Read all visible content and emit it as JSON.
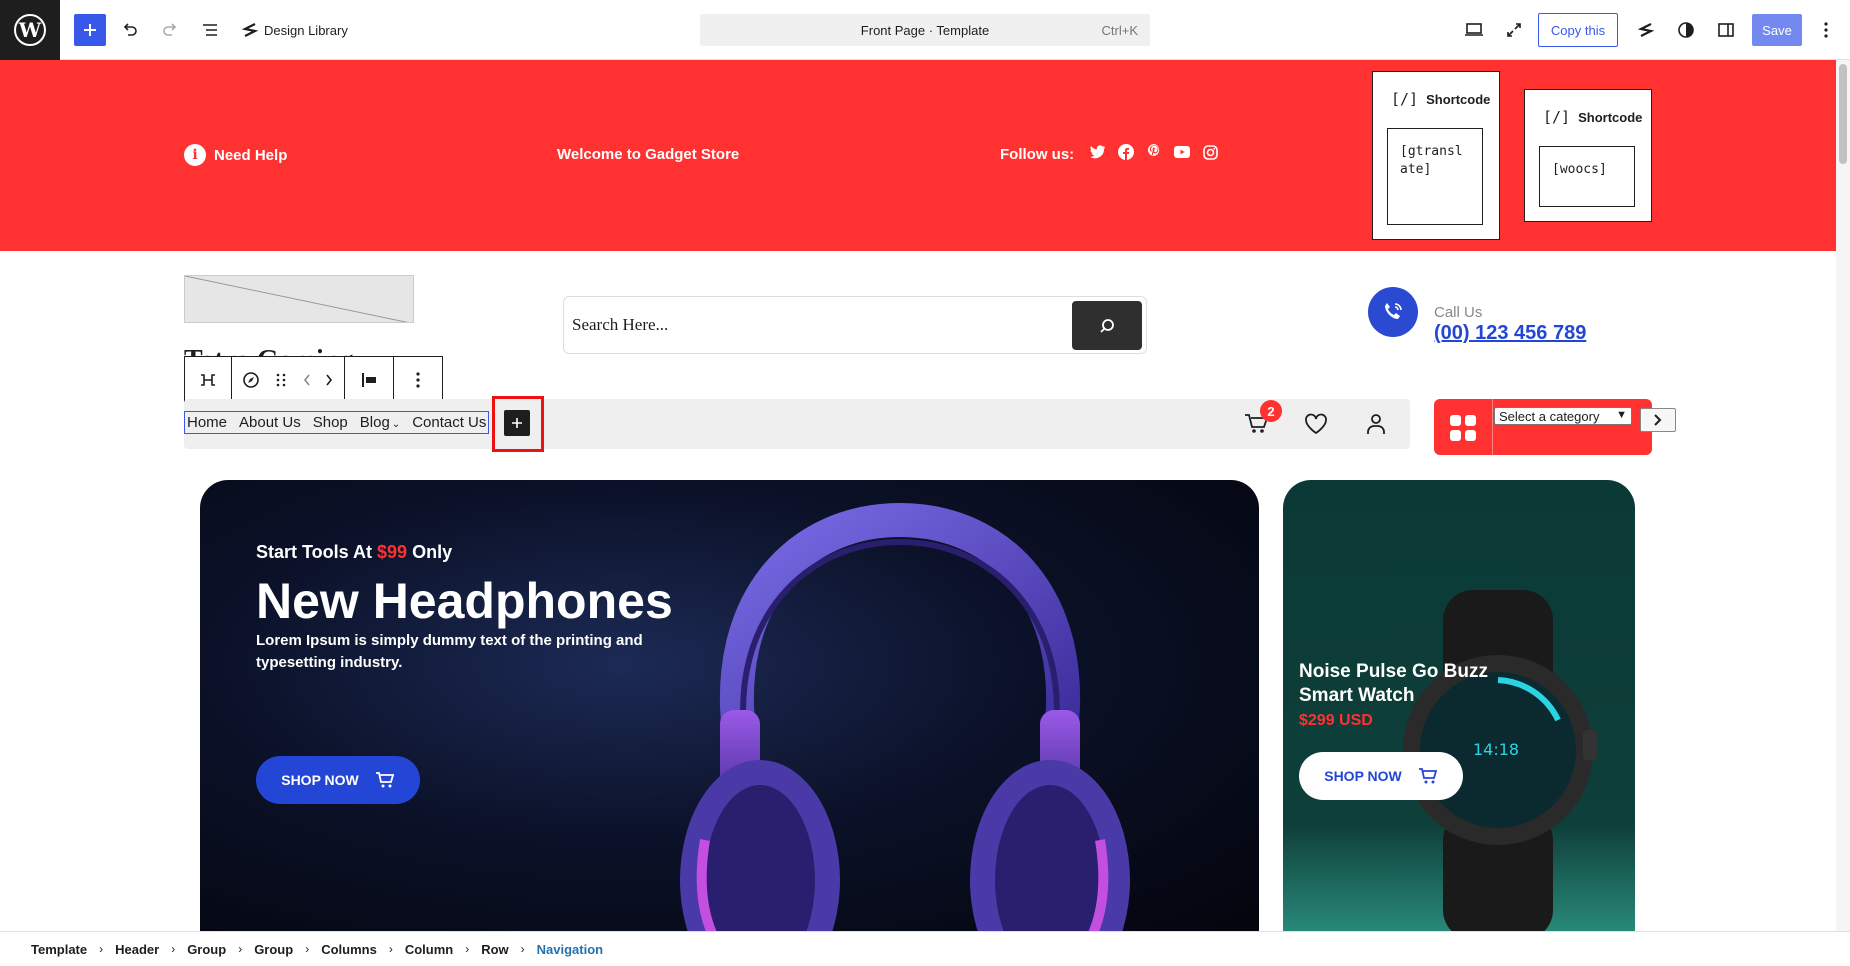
{
  "toolbar": {
    "design_library_label": "Design Library",
    "document_title": "Front Page · Template",
    "shortcut": "Ctrl+K",
    "copy_label": "Copy this",
    "save_label": "Save"
  },
  "topbar_strip": {
    "need_help": "Need Help",
    "welcome": "Welcome to Gadget Store",
    "follow_us": "Follow us:",
    "socials": [
      "twitter-icon",
      "facebook-icon",
      "pinterest-icon",
      "youtube-icon",
      "instagram-icon"
    ],
    "shortcodes": [
      {
        "heading": "Shortcode",
        "code": "[gtranslate]"
      },
      {
        "heading": "Shortcode",
        "code": "[woocs]"
      }
    ]
  },
  "header": {
    "site_title": "Tatra Gaming",
    "search_placeholder": "Search Here...",
    "call_label": "Call Us",
    "call_number": "(00) 123 456 789"
  },
  "nav": {
    "items": [
      "Home",
      "About Us",
      "Shop",
      "Blog",
      "Contact Us"
    ],
    "cart_count": "2",
    "category_select": "Select a category"
  },
  "hero": {
    "pre_text": "Start Tools At",
    "pre_price": "$99",
    "pre_suffix": "Only",
    "title": "New Headphones",
    "description": "Lorem Ipsum is simply dummy text of the printing and typesetting industry.",
    "button": "SHOP NOW"
  },
  "side_banner": {
    "title": "Noise Pulse Go Buzz Smart Watch",
    "price": "$299 USD",
    "button": "SHOP NOW"
  },
  "breadcrumbs": [
    "Template",
    "Header",
    "Group",
    "Group",
    "Columns",
    "Column",
    "Row",
    "Navigation"
  ],
  "colors": {
    "brand_red": "#ff3131",
    "accent_blue": "#3858e9",
    "link_blue": "#2446d6"
  }
}
